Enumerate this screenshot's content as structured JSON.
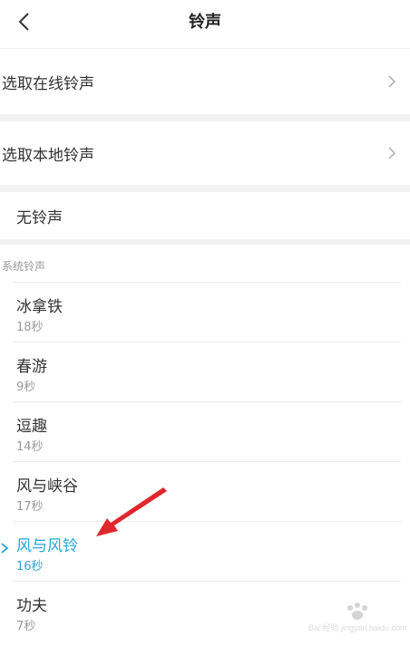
{
  "header": {
    "title": "铃声"
  },
  "options": {
    "online": "选取在线铃声",
    "local": "选取本地铃声",
    "none": "无铃声"
  },
  "section": {
    "system_label": "系统铃声"
  },
  "ringtones": [
    {
      "name": "冰拿铁",
      "duration": "18秒"
    },
    {
      "name": "春游",
      "duration": "9秒"
    },
    {
      "name": "逗趣",
      "duration": "14秒"
    },
    {
      "name": "风与峡谷",
      "duration": "17秒"
    },
    {
      "name": "风与风铃",
      "duration": "16秒",
      "selected": true
    },
    {
      "name": "功夫",
      "duration": "7秒"
    }
  ],
  "watermark": {
    "text": "Bai 经验 jingyan.baidu.com"
  },
  "colors": {
    "accent": "#2aa6d9",
    "arrow": "#e0272e",
    "gap": "#f2f2f2"
  }
}
